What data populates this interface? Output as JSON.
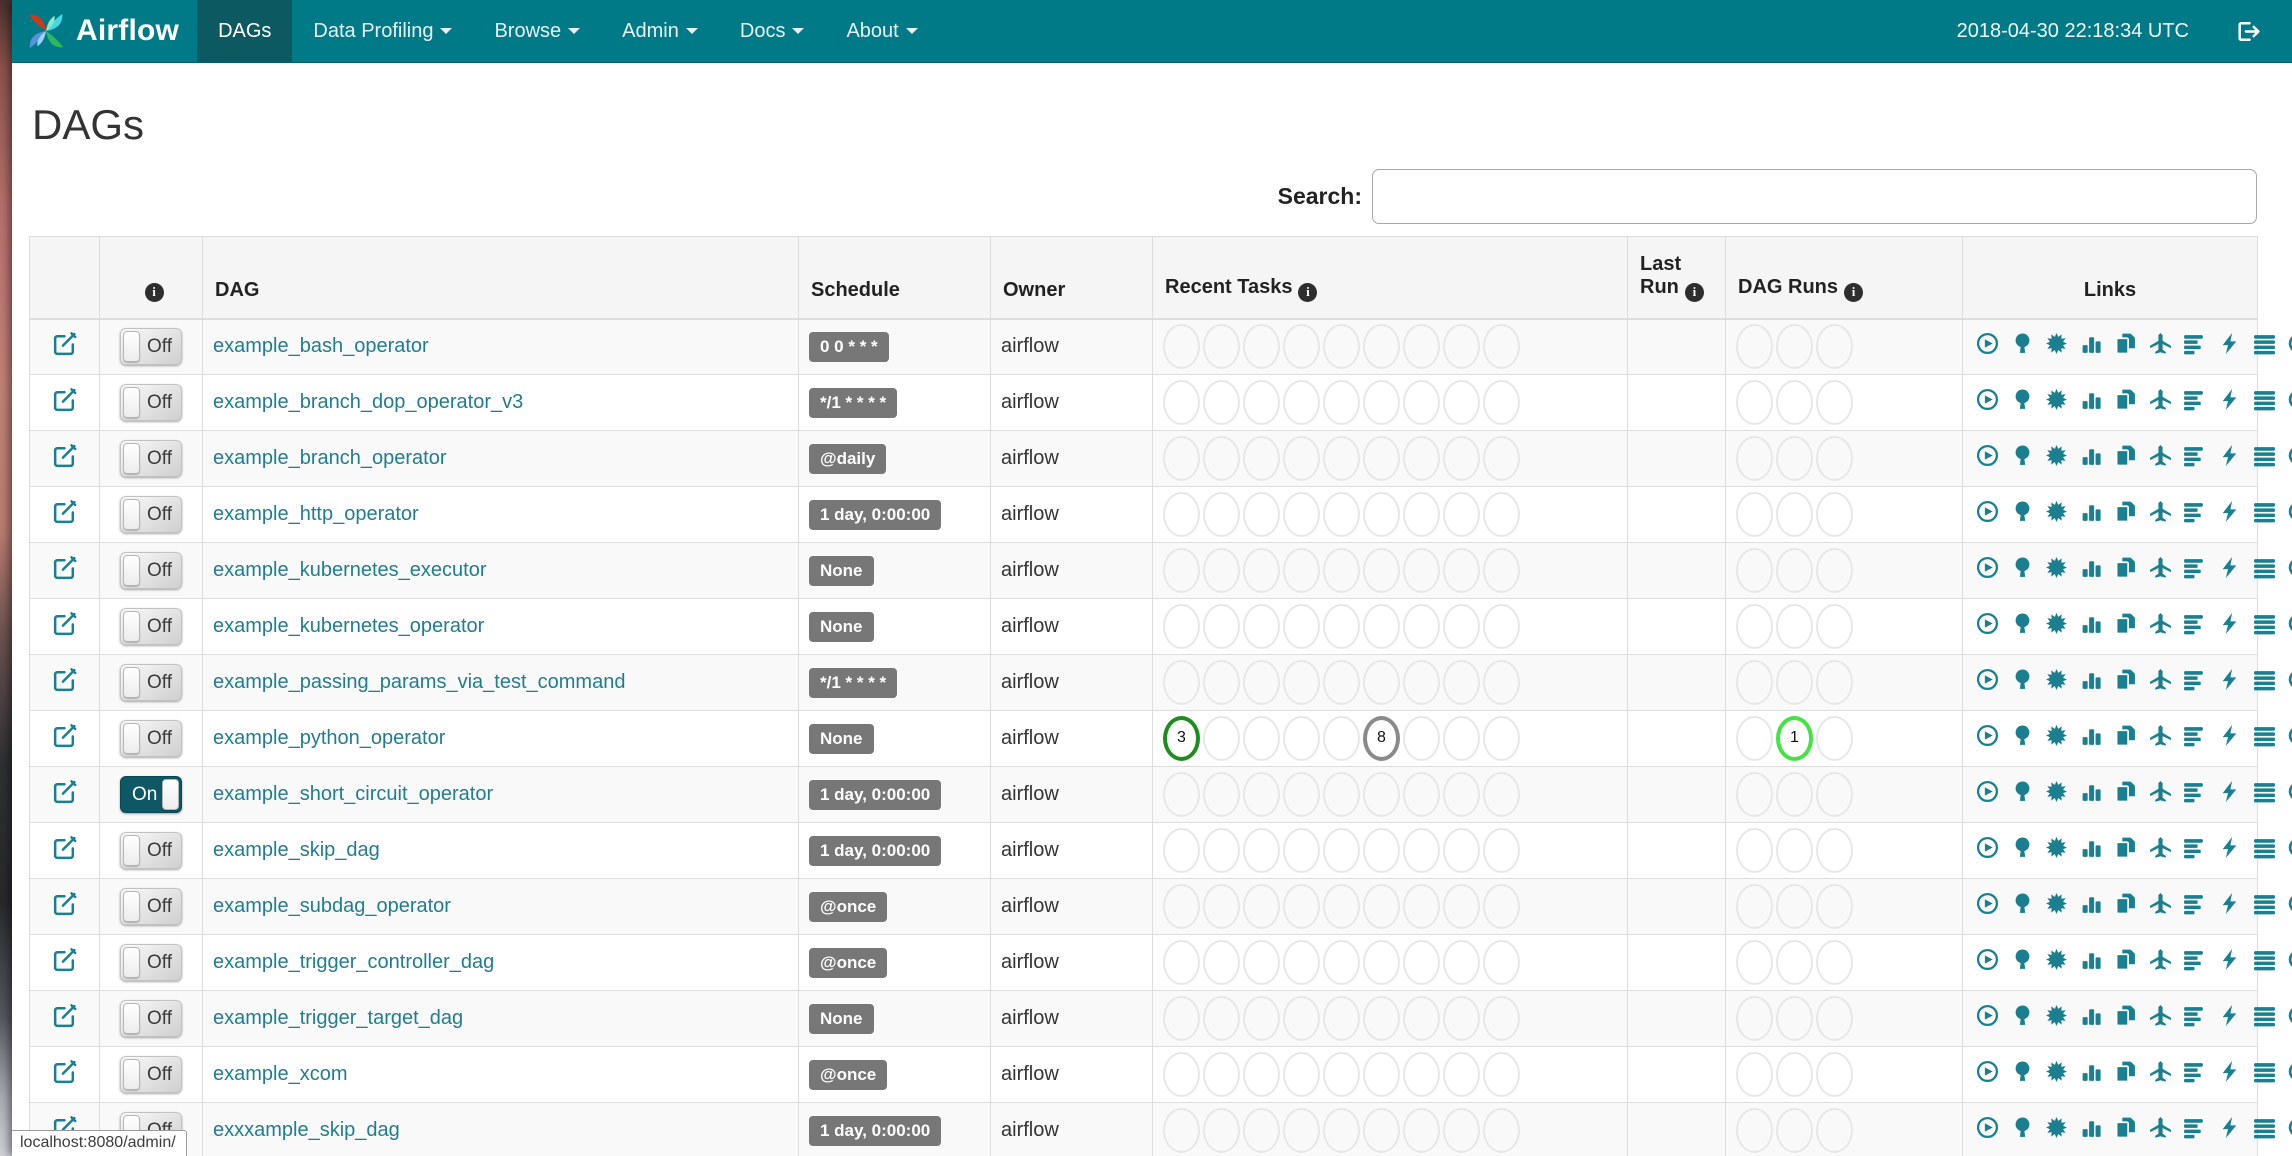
{
  "palette": {
    "navbar_teal": "#007a87",
    "navbar_active": "#0d5961",
    "link_teal": "#1f7e8e",
    "icon_teal": "#1a7f8e",
    "toggle_on": "#0e5866",
    "badge_gray": "#777777",
    "states": {
      "success": "#1e8c1e",
      "gray": "#8a8a8a",
      "running": "#43e343"
    }
  },
  "navbar": {
    "brand": "Airflow",
    "clock": "2018-04-30 22:18:34 UTC",
    "items": [
      {
        "label": "DAGs",
        "active": true,
        "caret": false
      },
      {
        "label": "Data Profiling",
        "active": false,
        "caret": true
      },
      {
        "label": "Browse",
        "active": false,
        "caret": true
      },
      {
        "label": "Admin",
        "active": false,
        "caret": true
      },
      {
        "label": "Docs",
        "active": false,
        "caret": true
      },
      {
        "label": "About",
        "active": false,
        "caret": true
      }
    ]
  },
  "page": {
    "title": "DAGs",
    "search_label": "Search:",
    "status_bar": "localhost:8080/admin/"
  },
  "table": {
    "headers": {
      "dag": "DAG",
      "schedule": "Schedule",
      "owner": "Owner",
      "recent_tasks": "Recent Tasks",
      "last_run_line1": "Last",
      "last_run_line2": "Run",
      "dag_runs": "DAG Runs",
      "links": "Links"
    },
    "info_icon_glyph": "i",
    "circle_slots": {
      "recent_tasks": 9,
      "dag_runs": 3
    },
    "link_icons": [
      "trigger-dag-icon",
      "tree-view-icon",
      "graph-view-icon",
      "task-duration-icon",
      "task-tries-icon",
      "landing-times-icon",
      "gantt-icon",
      "code-icon",
      "logs-icon",
      "refresh-icon"
    ],
    "rows": [
      {
        "name": "example_bash_operator",
        "toggle": "Off",
        "schedule": "0 0 * * *",
        "owner": "airflow",
        "recent_tasks": {},
        "dag_runs": {}
      },
      {
        "name": "example_branch_dop_operator_v3",
        "toggle": "Off",
        "schedule": "*/1 * * * *",
        "owner": "airflow",
        "recent_tasks": {},
        "dag_runs": {}
      },
      {
        "name": "example_branch_operator",
        "toggle": "Off",
        "schedule": "@daily",
        "owner": "airflow",
        "recent_tasks": {},
        "dag_runs": {}
      },
      {
        "name": "example_http_operator",
        "toggle": "Off",
        "schedule": "1 day, 0:00:00",
        "owner": "airflow",
        "recent_tasks": {},
        "dag_runs": {}
      },
      {
        "name": "example_kubernetes_executor",
        "toggle": "Off",
        "schedule": "None",
        "owner": "airflow",
        "recent_tasks": {},
        "dag_runs": {}
      },
      {
        "name": "example_kubernetes_operator",
        "toggle": "Off",
        "schedule": "None",
        "owner": "airflow",
        "recent_tasks": {},
        "dag_runs": {}
      },
      {
        "name": "example_passing_params_via_test_command",
        "toggle": "Off",
        "schedule": "*/1 * * * *",
        "owner": "airflow",
        "recent_tasks": {},
        "dag_runs": {}
      },
      {
        "name": "example_python_operator",
        "toggle": "Off",
        "schedule": "None",
        "owner": "airflow",
        "recent_tasks": {
          "0": {
            "count": "3",
            "state": "success"
          },
          "5": {
            "count": "8",
            "state": "gray"
          }
        },
        "dag_runs": {
          "1": {
            "count": "1",
            "state": "running"
          }
        }
      },
      {
        "name": "example_short_circuit_operator",
        "toggle": "On",
        "schedule": "1 day, 0:00:00",
        "owner": "airflow",
        "recent_tasks": {},
        "dag_runs": {}
      },
      {
        "name": "example_skip_dag",
        "toggle": "Off",
        "schedule": "1 day, 0:00:00",
        "owner": "airflow",
        "recent_tasks": {},
        "dag_runs": {}
      },
      {
        "name": "example_subdag_operator",
        "toggle": "Off",
        "schedule": "@once",
        "owner": "airflow",
        "recent_tasks": {},
        "dag_runs": {}
      },
      {
        "name": "example_trigger_controller_dag",
        "toggle": "Off",
        "schedule": "@once",
        "owner": "airflow",
        "recent_tasks": {},
        "dag_runs": {}
      },
      {
        "name": "example_trigger_target_dag",
        "toggle": "Off",
        "schedule": "None",
        "owner": "airflow",
        "recent_tasks": {},
        "dag_runs": {}
      },
      {
        "name": "example_xcom",
        "toggle": "Off",
        "schedule": "@once",
        "owner": "airflow",
        "recent_tasks": {},
        "dag_runs": {}
      },
      {
        "name": "exxxample_skip_dag",
        "toggle": "Off",
        "schedule": "1 day, 0:00:00",
        "owner": "airflow",
        "recent_tasks": {},
        "dag_runs": {}
      }
    ]
  }
}
